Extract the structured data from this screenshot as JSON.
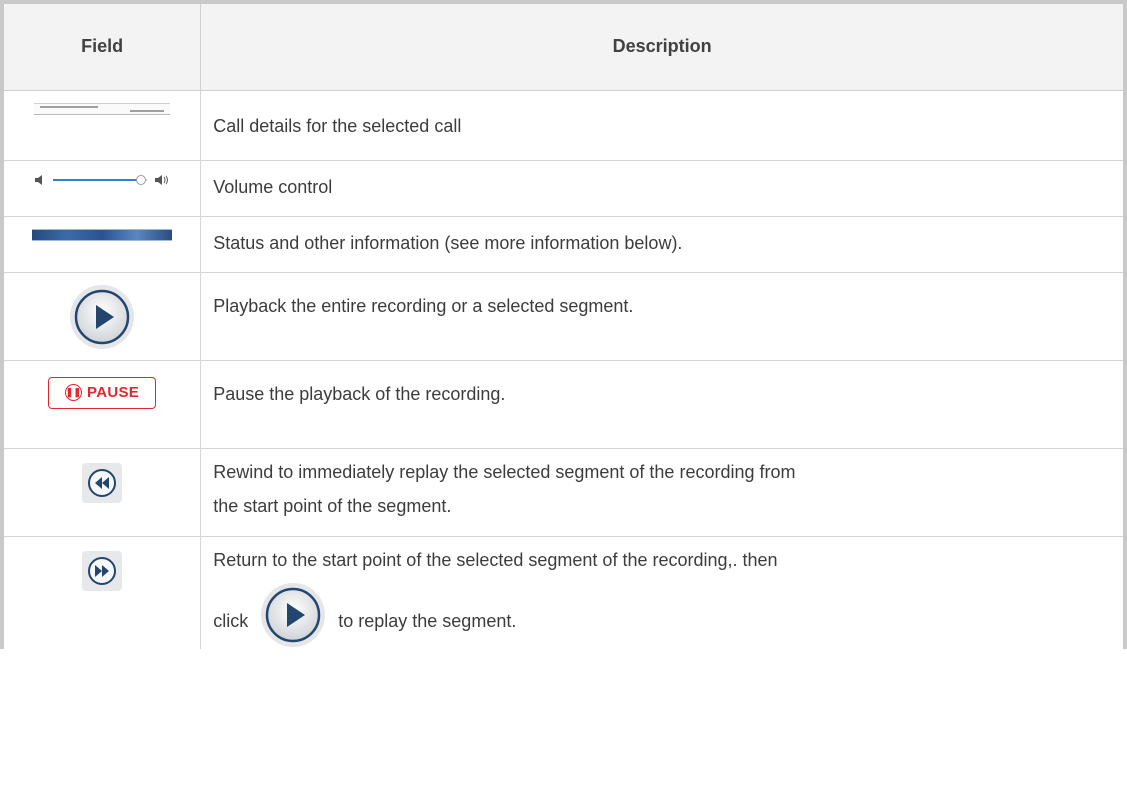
{
  "table": {
    "headers": {
      "field": "Field",
      "description": "Description"
    },
    "rows": [
      {
        "icon": "call-details-strip-icon",
        "description": "Call details for the selected call"
      },
      {
        "icon": "volume-slider-icon",
        "description": "Volume control"
      },
      {
        "icon": "waveform-status-icon",
        "description": "Status and other information (see more information below)."
      },
      {
        "icon": "play-icon",
        "description": "Playback the entire recording or a selected segment."
      },
      {
        "icon": "pause-icon",
        "button_label": "PAUSE",
        "description": "Pause the playback of the recording."
      },
      {
        "icon": "rewind-icon",
        "description_line1": "Rewind to immediately replay the selected segment of the recording from",
        "description_line2": "the start point of the segment."
      },
      {
        "icon": "forward-icon",
        "description_line1": "Return to the start point of the selected segment of the recording,. then",
        "description_line2_before": "click",
        "description_line2_after": "to replay the segment."
      }
    ]
  },
  "colors": {
    "header_bg": "#f3f3f3",
    "border": "#c9c9c9",
    "pause_red": "#e0282f",
    "accent_blue": "#2f7fd6"
  }
}
